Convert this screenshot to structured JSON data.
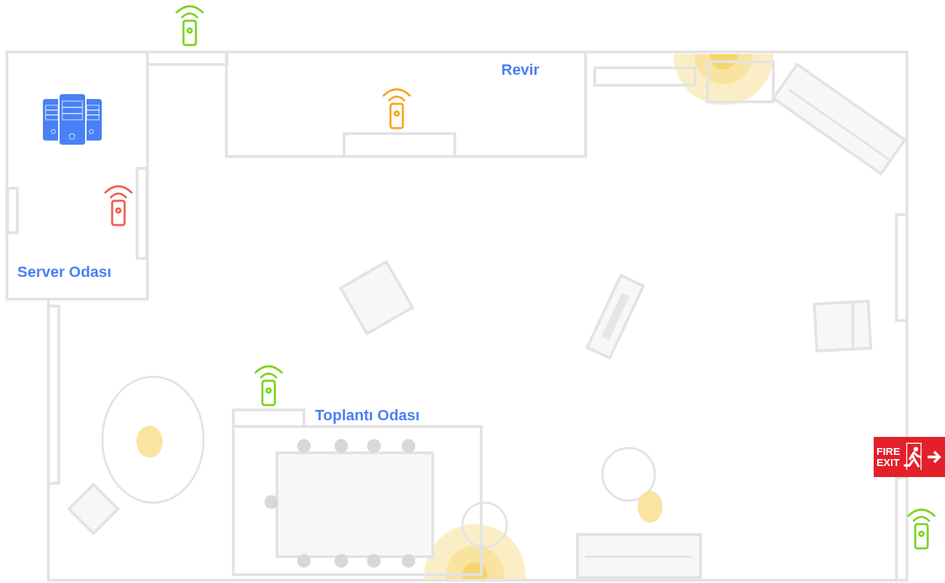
{
  "rooms": [
    {
      "label": "Revir"
    },
    {
      "label": "Server Odası"
    },
    {
      "label": "Toplantı Odası"
    }
  ],
  "sensors": [
    {
      "color": "#7ed321"
    },
    {
      "color": "#f5a623"
    },
    {
      "color": "#f25c54"
    },
    {
      "color": "#7ed321"
    },
    {
      "color": "#7ed321"
    }
  ],
  "fire_exit": {
    "line_1": "FIRE",
    "line_2": "EXIT"
  }
}
